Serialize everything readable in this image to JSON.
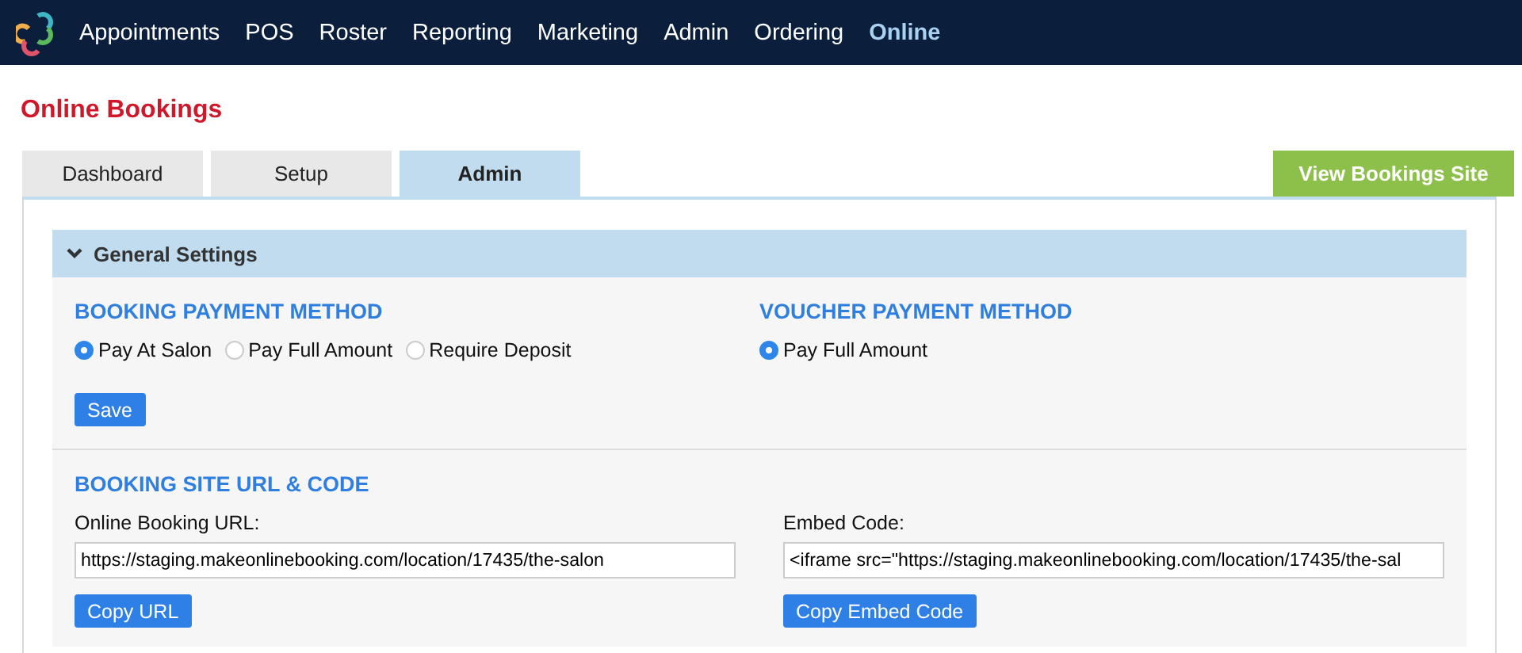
{
  "nav": {
    "items": [
      {
        "label": "Appointments",
        "selected": false
      },
      {
        "label": "POS",
        "selected": false
      },
      {
        "label": "Roster",
        "selected": false
      },
      {
        "label": "Reporting",
        "selected": false
      },
      {
        "label": "Marketing",
        "selected": false
      },
      {
        "label": "Admin",
        "selected": false
      },
      {
        "label": "Ordering",
        "selected": false
      },
      {
        "label": "Online",
        "selected": true
      }
    ]
  },
  "page_title": "Online Bookings",
  "tabs": [
    {
      "label": "Dashboard",
      "selected": false
    },
    {
      "label": "Setup",
      "selected": false
    },
    {
      "label": "Admin",
      "selected": true
    }
  ],
  "view_site_button": "View Bookings Site",
  "section": {
    "title": "General Settings",
    "expanded": true,
    "payment_groups": [
      {
        "heading": "BOOKING PAYMENT METHOD",
        "options": [
          {
            "label": "Pay At Salon",
            "selected": true
          },
          {
            "label": "Pay Full Amount",
            "selected": false
          },
          {
            "label": "Require Deposit",
            "selected": false
          }
        ],
        "button": "Save"
      },
      {
        "heading": "VOUCHER PAYMENT METHOD",
        "options": [
          {
            "label": "Pay Full Amount",
            "selected": true
          }
        ]
      }
    ],
    "url_heading": "BOOKING SITE URL & CODE",
    "fields": [
      {
        "label": "Online Booking URL:",
        "value": "https://staging.makeonlinebooking.com/location/17435/the-salon",
        "button": "Copy URL"
      },
      {
        "label": "Embed Code:",
        "value": "<iframe src=\"https://staging.makeonlinebooking.com/location/17435/the-sal",
        "button": "Copy Embed Code"
      }
    ]
  }
}
